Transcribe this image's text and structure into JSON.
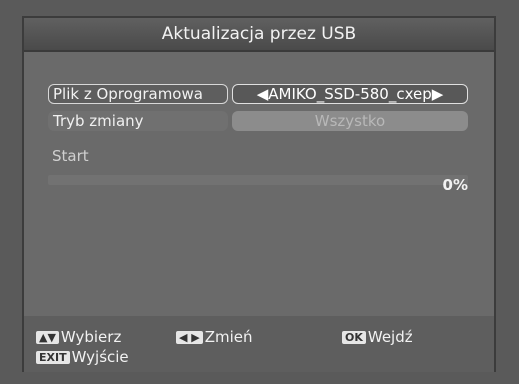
{
  "dialog": {
    "title": "Aktualizacja przez USB"
  },
  "rows": {
    "file_label": "Plik z Oprogramowa",
    "file_value": "◀AMIKO_SSD-580_cxep▶",
    "mode_label": "Tryb zmiany",
    "mode_value": "Wszystko",
    "start_label": "Start"
  },
  "progress": {
    "percent_text": "0%",
    "value": 0
  },
  "footer": {
    "select_key": "▲▼",
    "select_label": "Wybierz",
    "change_key": "◀ ▶",
    "change_label": "Zmień",
    "ok_key": "OK",
    "ok_label": "Wejdź",
    "exit_key": "EXIT",
    "exit_label": "Wyjście"
  }
}
